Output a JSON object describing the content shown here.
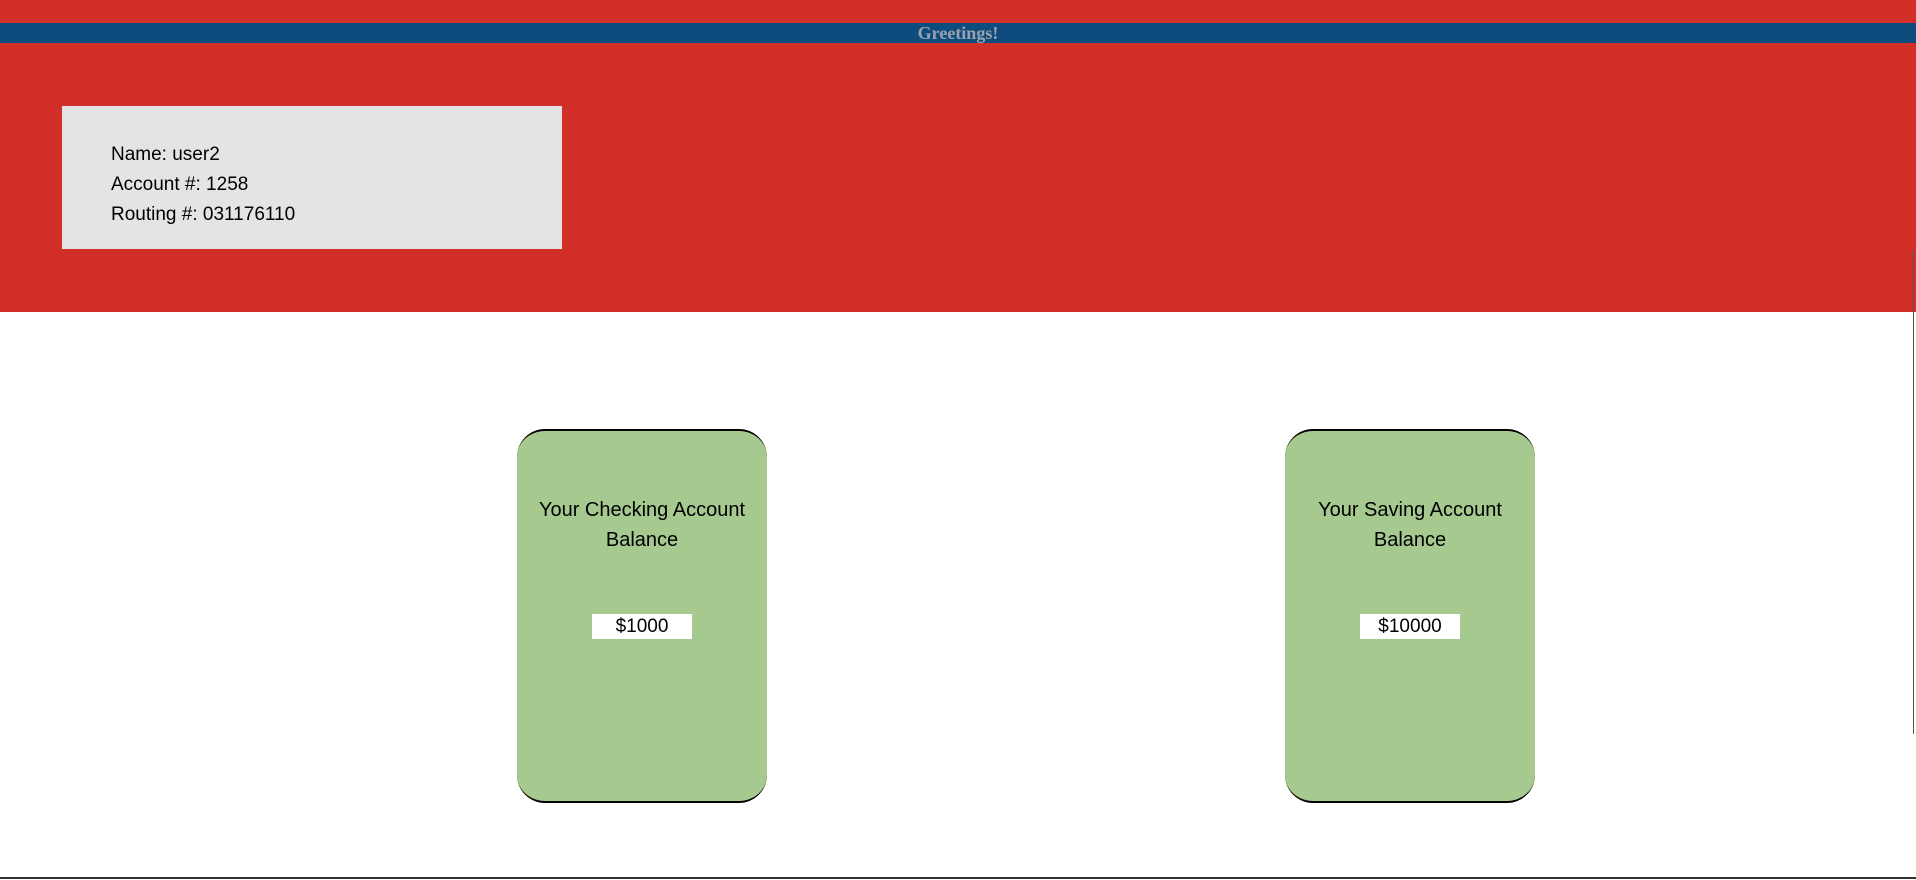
{
  "header": {
    "greeting": "Greetings!"
  },
  "account_info": {
    "name_line": "Name: user2",
    "account_line": "Account #: 1258",
    "routing_line": "Routing #: 031176110"
  },
  "cards": {
    "checking": {
      "title": "Your Checking Account Balance",
      "amount": "$1000"
    },
    "saving": {
      "title": "Your Saving Account Balance",
      "amount": "$10000"
    }
  },
  "colors": {
    "header_red": "#d22f29",
    "greeting_bar_blue": "#0f4c7e",
    "info_box_gray": "#e3e4e6",
    "card_green": "#a6c990"
  }
}
